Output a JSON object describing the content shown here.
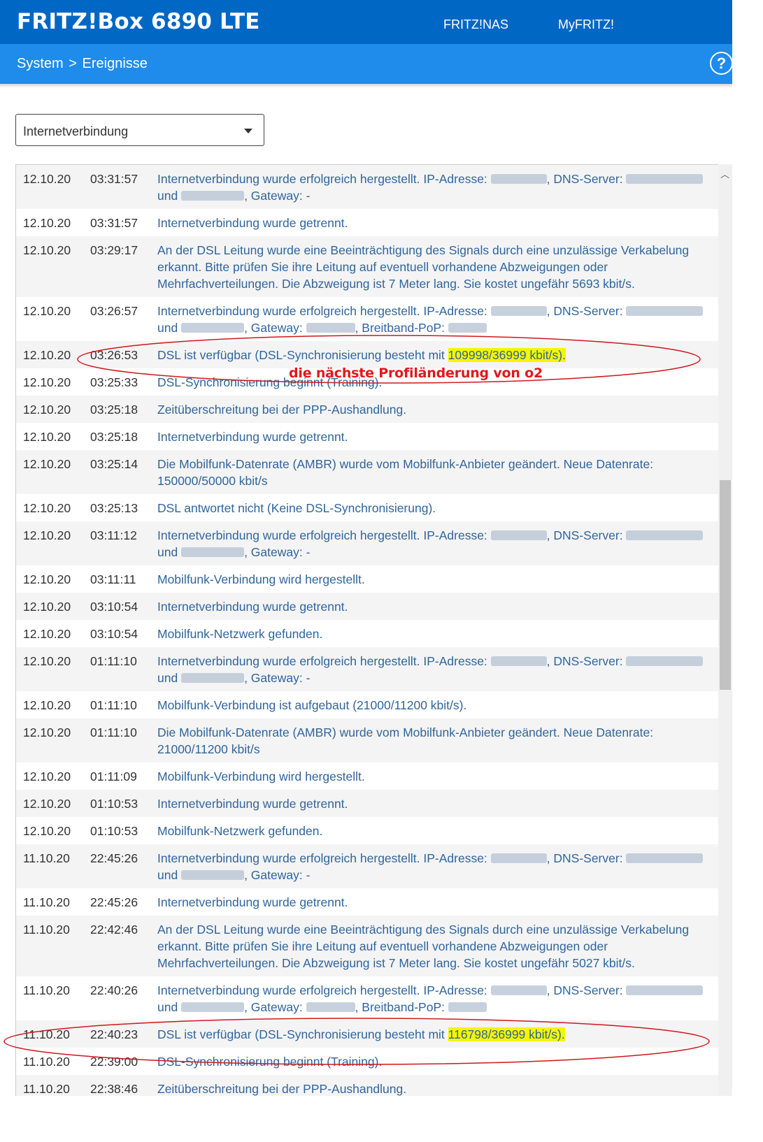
{
  "header": {
    "title": "FRITZ!Box 6890 LTE",
    "nav": [
      "FRITZ!NAS",
      "MyFRITZ!"
    ],
    "help_label": "?"
  },
  "breadcrumb": {
    "parent": "System",
    "separator": ">",
    "current": "Ereignisse"
  },
  "filter": {
    "selected": "Internetverbindung"
  },
  "annotation": {
    "text": "die nächste Profiländerung von o2",
    "color": "#e0181c"
  },
  "colors": {
    "topbar": "#0067c5",
    "subbar": "#1f8bea",
    "message": "#30659d",
    "highlight": "#f5f500"
  },
  "events": [
    {
      "date": "12.10.20",
      "time": "03:31:57",
      "parts": [
        {
          "t": "Internetverbindung wurde erfolgreich hergestellt. IP-Adresse: "
        },
        {
          "b": 1
        },
        {
          "t": ", DNS-Server: "
        },
        {
          "b": 1
        },
        {
          "t": " und "
        },
        {
          "b": 1
        },
        {
          "t": ", Gateway: -"
        }
      ]
    },
    {
      "date": "12.10.20",
      "time": "03:31:57",
      "parts": [
        {
          "t": "Internetverbindung wurde getrennt."
        }
      ]
    },
    {
      "date": "12.10.20",
      "time": "03:29:17",
      "parts": [
        {
          "t": "An der DSL Leitung wurde eine Beeinträchtigung des Signals durch eine unzulässige Verkabelung erkannt. Bitte prüfen Sie ihre Leitung auf eventuell vorhandene Abzweigungen oder Mehrfachverteilungen. Die Abzweigung ist 7 Meter lang. Sie kostet ungefähr 5693 kbit/s."
        }
      ]
    },
    {
      "date": "12.10.20",
      "time": "03:26:57",
      "parts": [
        {
          "t": "Internetverbindung wurde erfolgreich hergestellt. IP-Adresse: "
        },
        {
          "b": 1
        },
        {
          "t": ", DNS-Server: "
        },
        {
          "b": 1
        },
        {
          "t": " und "
        },
        {
          "b": 1
        },
        {
          "t": ", Gateway: "
        },
        {
          "b": 1
        },
        {
          "t": ", Breitband-PoP: "
        },
        {
          "b": 1
        }
      ]
    },
    {
      "date": "12.10.20",
      "time": "03:26:53",
      "parts": [
        {
          "t": "DSL ist verfügbar (DSL-Synchronisierung besteht mit "
        },
        {
          "h": "109998/36999 kbit/s)."
        }
      ]
    },
    {
      "date": "12.10.20",
      "time": "03:25:33",
      "parts": [
        {
          "t": "DSL-Synchronisierung beginnt (Training)."
        }
      ]
    },
    {
      "date": "12.10.20",
      "time": "03:25:18",
      "parts": [
        {
          "t": "Zeitüberschreitung bei der PPP-Aushandlung."
        }
      ]
    },
    {
      "date": "12.10.20",
      "time": "03:25:18",
      "parts": [
        {
          "t": "Internetverbindung wurde getrennt."
        }
      ]
    },
    {
      "date": "12.10.20",
      "time": "03:25:14",
      "parts": [
        {
          "t": "Die Mobilfunk-Datenrate (AMBR) wurde vom Mobilfunk-Anbieter geändert. Neue Datenrate: 150000/50000 kbit/s"
        }
      ]
    },
    {
      "date": "12.10.20",
      "time": "03:25:13",
      "parts": [
        {
          "t": "DSL antwortet nicht (Keine DSL-Synchronisierung)."
        }
      ]
    },
    {
      "date": "12.10.20",
      "time": "03:11:12",
      "parts": [
        {
          "t": "Internetverbindung wurde erfolgreich hergestellt. IP-Adresse: "
        },
        {
          "b": 1
        },
        {
          "t": ", DNS-Server: "
        },
        {
          "b": 1
        },
        {
          "t": " und "
        },
        {
          "b": 1
        },
        {
          "t": ", Gateway: -"
        }
      ]
    },
    {
      "date": "12.10.20",
      "time": "03:11:11",
      "parts": [
        {
          "t": "Mobilfunk-Verbindung wird hergestellt."
        }
      ]
    },
    {
      "date": "12.10.20",
      "time": "03:10:54",
      "parts": [
        {
          "t": "Internetverbindung wurde getrennt."
        }
      ]
    },
    {
      "date": "12.10.20",
      "time": "03:10:54",
      "parts": [
        {
          "t": "Mobilfunk-Netzwerk gefunden."
        }
      ]
    },
    {
      "date": "12.10.20",
      "time": "01:11:10",
      "parts": [
        {
          "t": "Internetverbindung wurde erfolgreich hergestellt. IP-Adresse: "
        },
        {
          "b": 1
        },
        {
          "t": ", DNS-Server: "
        },
        {
          "b": 1
        },
        {
          "t": " und "
        },
        {
          "b": 1
        },
        {
          "t": ", Gateway: -"
        }
      ]
    },
    {
      "date": "12.10.20",
      "time": "01:11:10",
      "parts": [
        {
          "t": "Mobilfunk-Verbindung ist aufgebaut (21000/11200 kbit/s)."
        }
      ]
    },
    {
      "date": "12.10.20",
      "time": "01:11:10",
      "parts": [
        {
          "t": "Die Mobilfunk-Datenrate (AMBR) wurde vom Mobilfunk-Anbieter geändert. Neue Datenrate: 21000/11200 kbit/s"
        }
      ]
    },
    {
      "date": "12.10.20",
      "time": "01:11:09",
      "parts": [
        {
          "t": "Mobilfunk-Verbindung wird hergestellt."
        }
      ]
    },
    {
      "date": "12.10.20",
      "time": "01:10:53",
      "parts": [
        {
          "t": "Internetverbindung wurde getrennt."
        }
      ]
    },
    {
      "date": "12.10.20",
      "time": "01:10:53",
      "parts": [
        {
          "t": "Mobilfunk-Netzwerk gefunden."
        }
      ]
    },
    {
      "date": "11.10.20",
      "time": "22:45:26",
      "parts": [
        {
          "t": "Internetverbindung wurde erfolgreich hergestellt. IP-Adresse: "
        },
        {
          "b": 1
        },
        {
          "t": ", DNS-Server: "
        },
        {
          "b": 1
        },
        {
          "t": " und "
        },
        {
          "b": 1
        },
        {
          "t": ", Gateway: -"
        }
      ]
    },
    {
      "date": "11.10.20",
      "time": "22:45:26",
      "parts": [
        {
          "t": "Internetverbindung wurde getrennt."
        }
      ]
    },
    {
      "date": "11.10.20",
      "time": "22:42:46",
      "parts": [
        {
          "t": "An der DSL Leitung wurde eine Beeinträchtigung des Signals durch eine unzulässige Verkabelung erkannt. Bitte prüfen Sie ihre Leitung auf eventuell vorhandene Abzweigungen oder Mehrfachverteilungen. Die Abzweigung ist 7 Meter lang. Sie kostet ungefähr 5027 kbit/s."
        }
      ]
    },
    {
      "date": "11.10.20",
      "time": "22:40:26",
      "parts": [
        {
          "t": "Internetverbindung wurde erfolgreich hergestellt. IP-Adresse: "
        },
        {
          "b": 1
        },
        {
          "t": ", DNS-Server: "
        },
        {
          "b": 1
        },
        {
          "t": " und "
        },
        {
          "b": 1
        },
        {
          "t": ", Gateway: "
        },
        {
          "b": 1
        },
        {
          "t": ", Breitband-PoP: "
        },
        {
          "b": 1
        }
      ]
    },
    {
      "date": "11.10.20",
      "time": "22:40:23",
      "parts": [
        {
          "t": "DSL ist verfügbar (DSL-Synchronisierung besteht mit "
        },
        {
          "h": "116798/36999 kbit/s)."
        }
      ]
    },
    {
      "date": "11.10.20",
      "time": "22:39:00",
      "parts": [
        {
          "t": "DSL-Synchronisierung beginnt (Training)."
        }
      ]
    },
    {
      "date": "11.10.20",
      "time": "22:38:46",
      "parts": [
        {
          "t": "Zeitüberschreitung bei der PPP-Aushandlung."
        }
      ]
    }
  ]
}
